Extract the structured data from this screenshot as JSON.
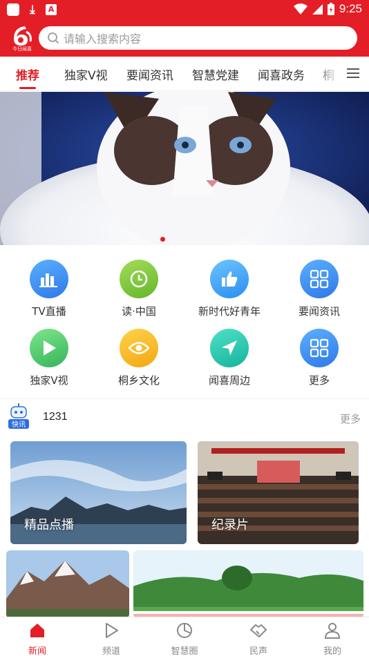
{
  "status_bar": {
    "time": "9:25",
    "badge": "A"
  },
  "app": {
    "logo_text": "今日闻喜"
  },
  "search": {
    "placeholder": "请输入搜索内容"
  },
  "tabs": [
    {
      "label": "推荐",
      "active": true
    },
    {
      "label": "独家V视"
    },
    {
      "label": "要闻资讯"
    },
    {
      "label": "智慧党建"
    },
    {
      "label": "闻喜政务"
    },
    {
      "label": "桐"
    }
  ],
  "grid": [
    {
      "label": "TV直播",
      "icon": "bar-chart-icon",
      "color": "#3d8ef0"
    },
    {
      "label": "读·中国",
      "icon": "clock-icon",
      "color": "#7dc23b"
    },
    {
      "label": "新时代好青年",
      "icon": "thumbs-up-icon",
      "color": "#3aa0f2"
    },
    {
      "label": "要闻资讯",
      "icon": "grid-icon",
      "color": "#3d8ef0"
    },
    {
      "label": "独家V视",
      "icon": "play-icon",
      "color": "#4cc26a"
    },
    {
      "label": "桐乡文化",
      "icon": "eye-icon",
      "color": "#f6b91c"
    },
    {
      "label": "闻喜周边",
      "icon": "location-arrow-icon",
      "color": "#25c6b0"
    },
    {
      "label": "更多",
      "icon": "grid-icon",
      "color": "#3d8ef0"
    }
  ],
  "news": {
    "badge": "快讯",
    "title": "1231",
    "more": "更多"
  },
  "cards": [
    {
      "label": "精品点播"
    },
    {
      "label": "纪录片"
    }
  ],
  "bottom_nav": [
    {
      "label": "新闻",
      "icon": "home-icon",
      "active": true
    },
    {
      "label": "频道",
      "icon": "play-icon"
    },
    {
      "label": "智慧圈",
      "icon": "pie-chart-icon"
    },
    {
      "label": "民声",
      "icon": "handshake-icon"
    },
    {
      "label": "我的",
      "icon": "user-icon"
    }
  ],
  "colors": {
    "brand": "#e41e26"
  }
}
